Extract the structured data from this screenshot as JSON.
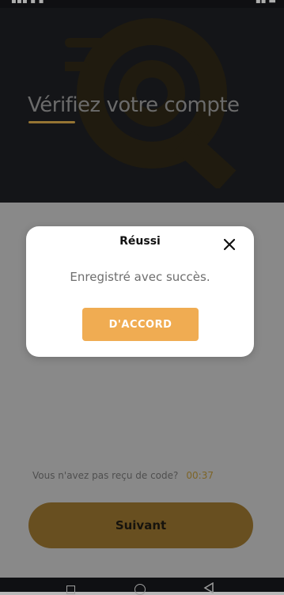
{
  "header": {
    "title": "Vérifiez votre compte"
  },
  "resend": {
    "prompt": "Vous n'avez pas reçu de code?",
    "timer": "00:37"
  },
  "footer": {
    "next_label": "Suivant"
  },
  "dialog": {
    "title": "Réussi",
    "message": "Enregistré avec succès.",
    "ok_label": "D'ACCORD",
    "close_icon": "close-icon"
  },
  "colors": {
    "accent": "#f0ac52",
    "header_bg": "#1b1c20",
    "underline": "#c79b44"
  }
}
